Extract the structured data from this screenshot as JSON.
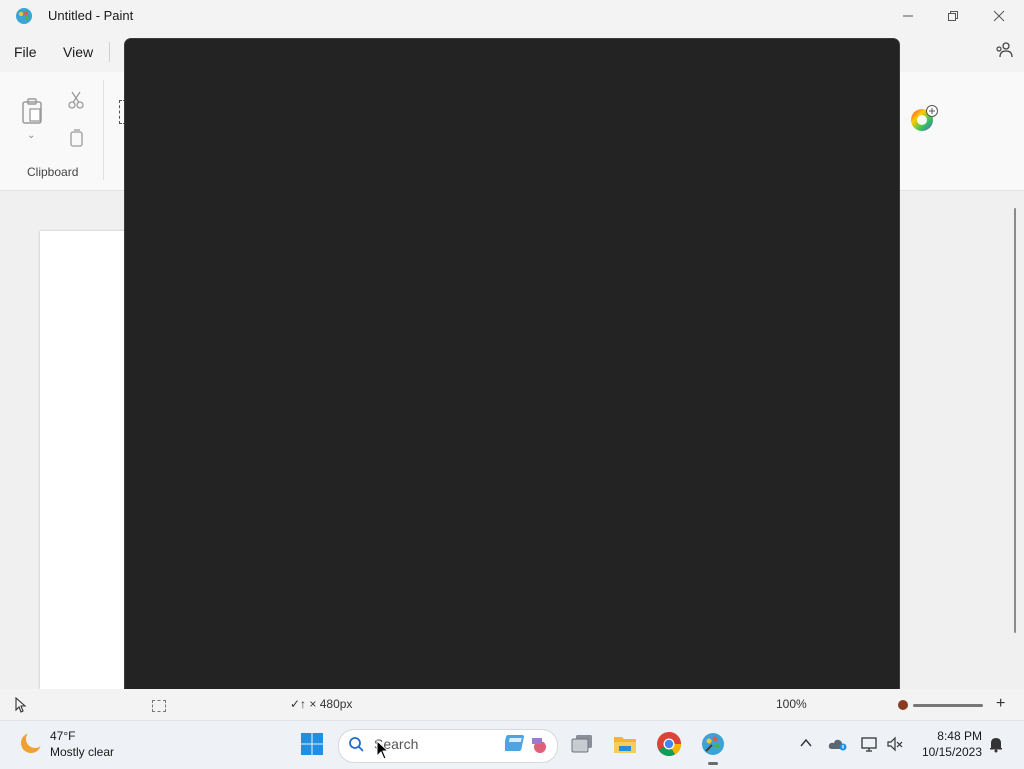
{
  "window": {
    "title": "Untitled - Paint"
  },
  "menu": {
    "file": "File",
    "view": "View"
  },
  "ribbon": {
    "clipboard_label": "Clipboard"
  },
  "statusbar": {
    "size_text": "✓↑ × 480px",
    "zoom_text": "100%",
    "zoom_color": "#8a3b1f"
  },
  "overlay": {
    "color": "#232323"
  },
  "taskbar": {
    "weather": {
      "temp": "47°F",
      "desc": "Mostly clear"
    },
    "search": {
      "placeholder": "Search"
    },
    "clock": {
      "time": "8:48 PM",
      "date": "10/15/2023"
    },
    "pinned_apps": [
      "task-view",
      "file-explorer",
      "chrome",
      "paint"
    ],
    "active_app": "paint"
  }
}
